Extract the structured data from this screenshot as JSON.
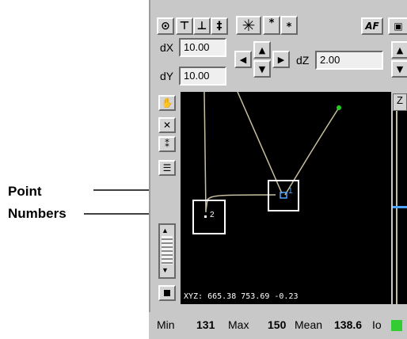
{
  "callouts": {
    "line1": "Point",
    "line2": "Numbers"
  },
  "toolbar": {
    "af_label": "AF"
  },
  "fields": {
    "dx_label": "dX",
    "dx_value": "10.00",
    "dy_label": "dY",
    "dy_value": "10.00",
    "dz_label": "dZ",
    "dz_value": "2.00"
  },
  "viewport": {
    "xyz_readout": "XYZ: 665.38 753.69 -0.23",
    "point_labels": [
      "1",
      "2"
    ],
    "second_panel_label": "Z"
  },
  "status": {
    "min_label": "Min",
    "min_value": "131",
    "max_label": "Max",
    "max_value": "150",
    "mean_label": "Mean",
    "mean_value": "138.6",
    "io_label": "Io"
  },
  "colors": {
    "indicator": "#33cc33",
    "trace": "#c8bfa0",
    "point_marker": "#4fa3ff",
    "endpoint": "#22cc22"
  }
}
